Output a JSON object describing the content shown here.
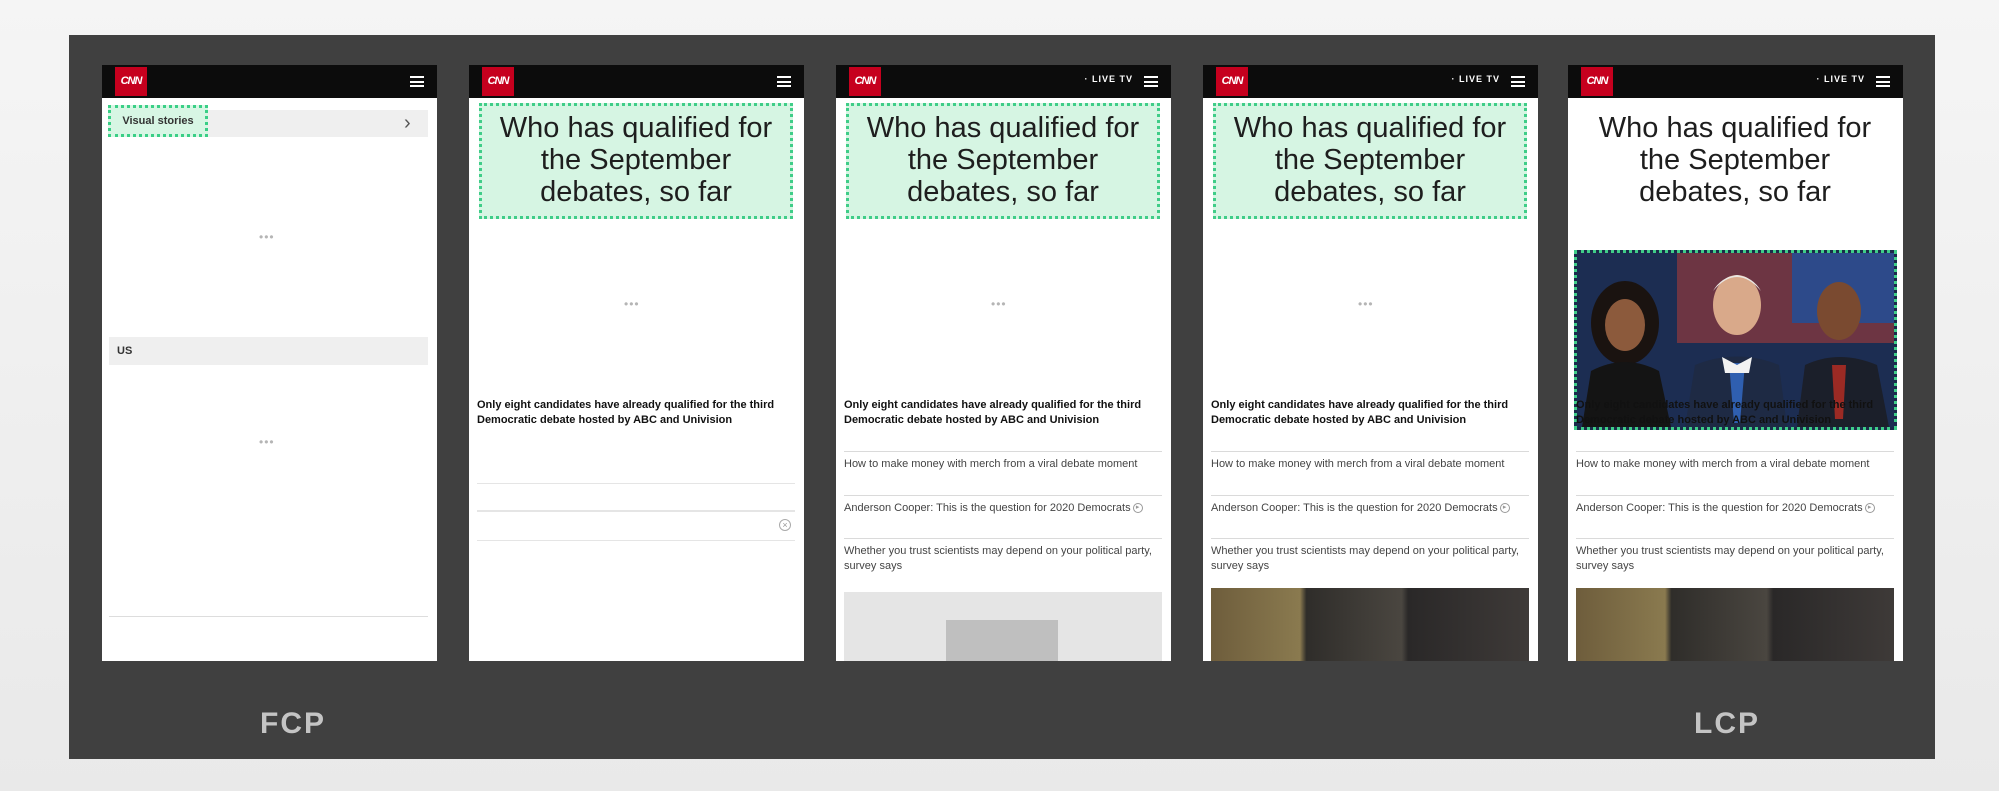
{
  "brand": {
    "logo_text": "CNN",
    "live_tv": "· LIVE TV"
  },
  "frame1": {
    "visual_stories_label": "Visual stories",
    "section_label": "US",
    "loading_dots": "•••"
  },
  "article": {
    "headline": "Who has qualified for the September debates, so far",
    "lead": "Only eight candidates have already qualified for the third Democratic debate hosted by ABC and Univision",
    "stories": [
      "How to make money with merch from a viral debate moment",
      "Anderson Cooper: This is the question for 2020 Democrats",
      "Whether you trust scientists may depend on your political party, survey says"
    ],
    "loading_dots": "•••"
  },
  "captions": {
    "left": "FCP",
    "right": "LCP"
  },
  "colors": {
    "highlight_fill": "#d6f5e3",
    "highlight_border": "#3fcd88",
    "brand_red": "#c6001e",
    "panel": "#404040"
  },
  "icons": [
    "cnn-logo",
    "hamburger-menu-icon",
    "chevron-right-icon",
    "close-circle-icon",
    "play-circle-icon"
  ]
}
